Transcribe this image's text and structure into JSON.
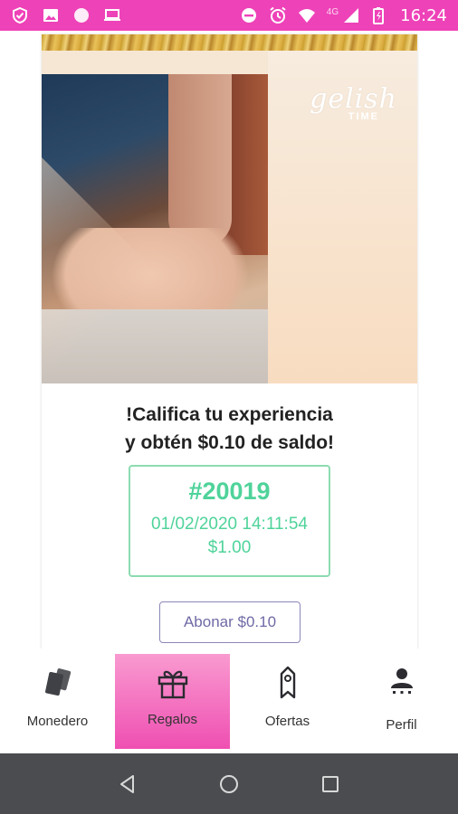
{
  "status_bar": {
    "network_label": "4G",
    "time": "16:24",
    "icons": [
      "shield-icon",
      "image-icon",
      "circle-icon",
      "laptop-icon",
      "dnd-icon",
      "alarm-icon",
      "wifi-icon",
      "signal-icon",
      "battery-icon"
    ],
    "background": "#ee42b8"
  },
  "promo": {
    "logo_text": "gelish",
    "logo_subtext": "TIME"
  },
  "rating": {
    "headline_line1": "!Califica tu experiencia",
    "headline_line2": "y obtén $0.10 de saldo!",
    "ticket_id": "#20019",
    "ticket_datetime": "01/02/2020 14:11:54",
    "ticket_amount": "$1.00",
    "accent_color": "#4fd39a",
    "button_label": "Abonar $0.10"
  },
  "tabbar": {
    "active_tab": "Regalos",
    "active_color": "#ef4fb2",
    "tabs": [
      {
        "label": "Monedero",
        "icon": "wallet-cards-icon"
      },
      {
        "label": "Regalos",
        "icon": "gift-icon"
      },
      {
        "label": "Ofertas",
        "icon": "tag-icon"
      },
      {
        "label": "Perfil",
        "icon": "person-icon"
      }
    ]
  },
  "system_nav": {
    "buttons": [
      "back-icon",
      "home-icon",
      "recents-icon"
    ]
  }
}
